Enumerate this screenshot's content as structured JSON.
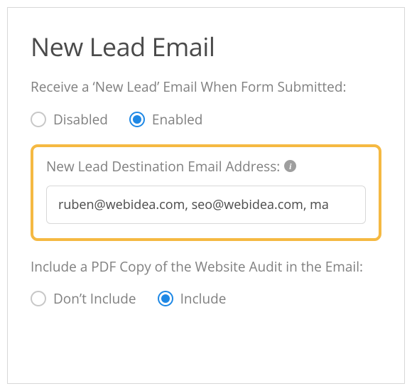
{
  "title": "New Lead Email",
  "section1": {
    "label": "Receive a ‘New Lead’ Email When Form Submitted:",
    "options": {
      "disabled": "Disabled",
      "enabled": "Enabled"
    },
    "selected": "enabled"
  },
  "destination": {
    "label": "New Lead Destination Email Address:",
    "info_icon": "info-icon",
    "value": "ruben@webidea.com, seo@webidea.com, ma"
  },
  "section2": {
    "label": "Include a PDF Copy of the Website Audit in the Email:",
    "options": {
      "dont_include": "Don’t Include",
      "include": "Include"
    },
    "selected": "include"
  }
}
